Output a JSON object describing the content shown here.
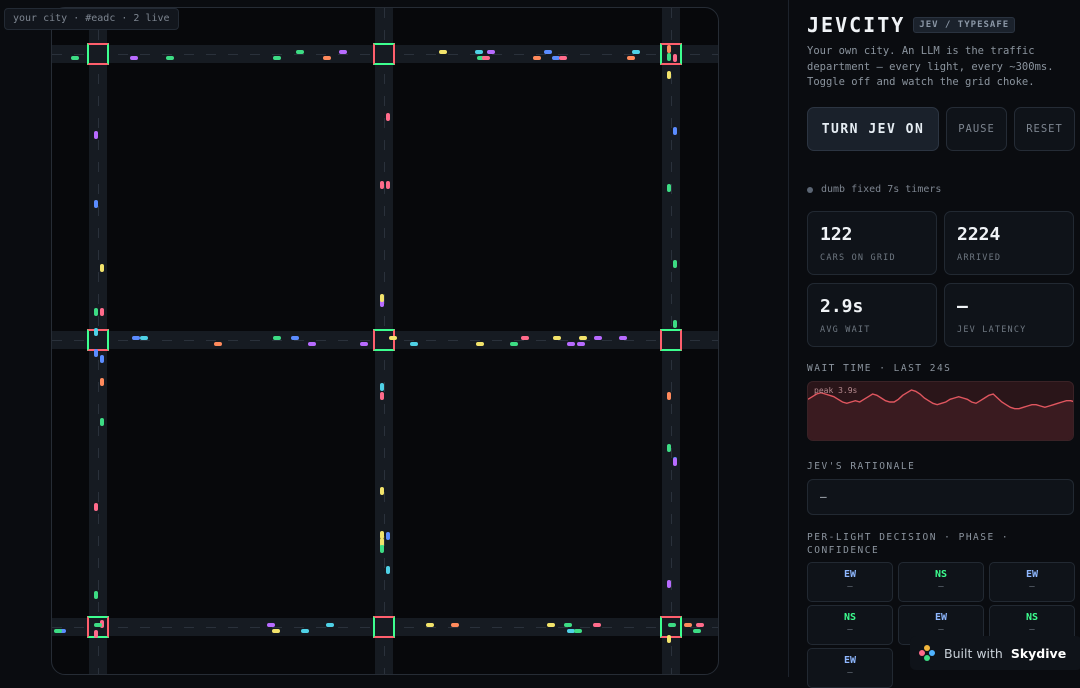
{
  "badge": "your city · #eadc · 2 live",
  "brand": {
    "title": "JEVCITY",
    "tag": "JEV / TYPESAFE"
  },
  "intro": "Your own city. An LLM is the traffic department — every light, every ~300ms. Toggle off and watch the grid choke.",
  "controls": {
    "toggle": "TURN JEV ON",
    "pause": "PAUSE",
    "reset": "RESET"
  },
  "status": "dumb fixed 7s timers",
  "stats": {
    "cars": {
      "value": "122",
      "label": "CARS ON GRID"
    },
    "arrived": {
      "value": "2224",
      "label": "ARRIVED"
    },
    "wait": {
      "value": "2.9s",
      "label": "AVG WAIT"
    },
    "latency": {
      "value": "—",
      "label": "JEV LATENCY"
    }
  },
  "wait_chart": {
    "label": "WAIT TIME · LAST 24S",
    "peak": "peak 3.9s",
    "line_color": "#e0565f",
    "values": [
      3.2,
      3.4,
      3.6,
      3.7,
      3.6,
      3.5,
      3.4,
      3.2,
      3.0,
      2.9,
      3.0,
      3.1,
      3.0,
      3.2,
      3.4,
      3.6,
      3.5,
      3.3,
      3.1,
      3.0,
      3.0,
      3.2,
      3.5,
      3.7,
      3.9,
      3.8,
      3.6,
      3.3,
      3.1,
      2.9,
      2.8,
      2.9,
      3.0,
      3.2,
      3.3,
      3.4,
      3.3,
      3.2,
      3.0,
      2.9,
      3.1,
      3.3,
      3.5,
      3.6,
      3.3,
      3.0,
      2.8,
      2.6,
      2.5,
      2.5,
      2.6,
      2.7,
      2.8,
      2.8,
      2.7,
      2.6,
      2.7,
      2.8,
      2.9,
      3.0,
      3.1,
      3.1,
      3.0
    ],
    "ymax": 4.5
  },
  "rationale": {
    "label": "JEV'S RATIONALE",
    "text": "—"
  },
  "decisions": {
    "label": "PER-LIGHT DECISION · PHASE · CONFIDENCE",
    "cells": [
      {
        "phase": "EW",
        "conf": "—"
      },
      {
        "phase": "NS",
        "conf": "—"
      },
      {
        "phase": "EW",
        "conf": "—"
      },
      {
        "phase": "NS",
        "conf": "—"
      },
      {
        "phase": "EW",
        "conf": "—"
      },
      {
        "phase": "NS",
        "conf": "—"
      },
      {
        "phase": "EW",
        "conf": "—"
      }
    ]
  },
  "map": {
    "lights": [
      {
        "phase": "EW"
      },
      {
        "phase": "NS"
      },
      {
        "phase": "EW"
      },
      {
        "phase": "EW"
      },
      {
        "phase": "NS"
      },
      {
        "phase": "NS"
      },
      {
        "phase": "NS"
      },
      {
        "phase": "EW"
      },
      {
        "phase": "EW"
      }
    ]
  },
  "footer": {
    "prefix": "Built with",
    "brand": "Skydive"
  }
}
